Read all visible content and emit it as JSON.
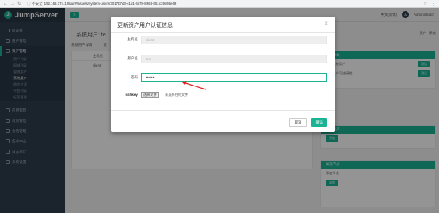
{
  "browser": {
    "insecure_label": "不安全",
    "url": "192.168.174.128/ui/#/assets/system-users/3017b7d3-c1d1-4c78-8963-b51c39c9be69"
  },
  "sidebar": {
    "logo_text": "JumpServer",
    "logo_mark": "J",
    "items": [
      {
        "label": "仪表盘"
      },
      {
        "label": "用户管理"
      },
      {
        "label": "资产管理"
      },
      {
        "label": "资产列表"
      },
      {
        "label": "网域列表"
      },
      {
        "label": "管理用户"
      },
      {
        "label": "系统用户"
      },
      {
        "label": "命令过滤"
      },
      {
        "label": "平台列表"
      },
      {
        "label": "标签管理"
      },
      {
        "label": "应用管理"
      },
      {
        "label": "权限管理"
      },
      {
        "label": "会话管理"
      },
      {
        "label": "作业中心"
      },
      {
        "label": "日志审计"
      },
      {
        "label": "系统设置"
      }
    ]
  },
  "header": {
    "language": "中文(简体)",
    "user": "Administrator",
    "avatar_text": "A"
  },
  "page": {
    "title": "系统用户: te",
    "crumb_a": "资产",
    "crumb_b": "系统",
    "tabs": [
      "系统用户详情",
      "资"
    ],
    "table_header": "主机名",
    "table_cell": "client",
    "right_head_1": "快速修改",
    "right_row_1a": "推送系统用户",
    "right_row_1b": "测试",
    "right_row_2a": "测试资产可连接性",
    "right_row_2b": "测试",
    "right_head_2": "关联资产",
    "right_btn_add": "添加",
    "right_head_3": "关联节点",
    "right_row_3": "添加节点",
    "right_btn_add2": "添加"
  },
  "modal": {
    "title": "更新资产用户认证信息",
    "hostname_label": "主机名",
    "hostname_value": "client",
    "username_label": "用户名",
    "username_value": "test",
    "password_label": "密码",
    "password_value": "••••••",
    "sshkey_label": "sshkey",
    "file_button": "选择文件",
    "file_status": "未选择任何文件",
    "cancel_label": "取消",
    "confirm_label": "确认"
  },
  "colors": {
    "accent": "#1ab394",
    "sidebar_bg": "#2f3e4d",
    "annotation_arrow": "#e02020"
  }
}
